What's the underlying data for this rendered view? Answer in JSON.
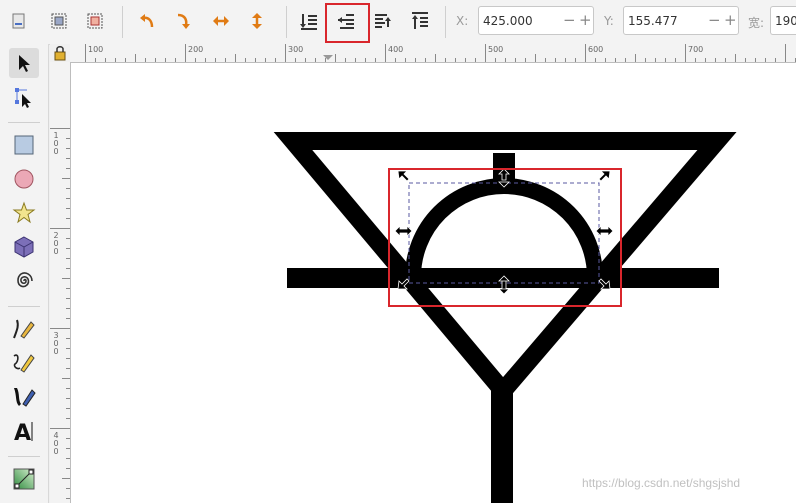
{
  "toolbar": {
    "x_label": "X:",
    "x_value": "425.000",
    "y_label": "Y:",
    "y_value": "155.477",
    "w_label": "宽:",
    "w_value": "190",
    "minus": "−",
    "plus": "+",
    "highlight_color": "#d9262c"
  },
  "ruler": {
    "h_labels": [
      "100",
      "200",
      "300",
      "400",
      "500",
      "600",
      "700"
    ],
    "v_labels": [
      "100",
      "200",
      "300",
      "400"
    ]
  },
  "watermark": "https://blog.csdn.net/shgsjshd"
}
